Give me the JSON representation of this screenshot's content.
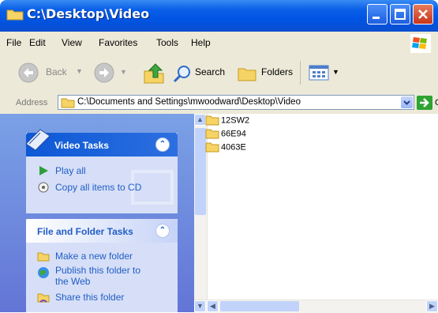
{
  "window": {
    "title": "C:\\Desktop\\Video"
  },
  "menu": [
    "File",
    "Edit",
    "View",
    "Favorites",
    "Tools",
    "Help"
  ],
  "toolbar": {
    "back": "Back",
    "search": "Search",
    "folders": "Folders"
  },
  "address": {
    "label": "Address",
    "path": "C:\\Documents and Settings\\mwoodward\\Desktop\\Video",
    "go": "Go"
  },
  "video_tasks": {
    "title": "Video Tasks",
    "items": [
      "Play all",
      "Copy all items to CD"
    ]
  },
  "file_tasks": {
    "title": "File and Folder Tasks",
    "items": [
      "Make a new folder",
      "Publish this folder to",
      "the Web",
      "Share this folder"
    ]
  },
  "files": [
    "12SW2",
    "66E94",
    "4063E"
  ]
}
